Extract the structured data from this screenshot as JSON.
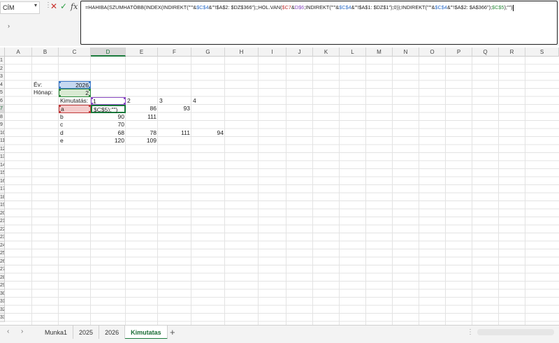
{
  "formula_bar": {
    "name_box": "CÍM",
    "formula_parts": [
      {
        "t": "=HAHIBA(SZUMHATÖBB(INDEX(INDIREKT(\"'\"&",
        "c": ""
      },
      {
        "t": "$C$4",
        "c": "ref-blue"
      },
      {
        "t": "&\"'!$A$2: $DZ$366\");;HOL.VAN(",
        "c": ""
      },
      {
        "t": "$C7",
        "c": "ref-red"
      },
      {
        "t": "&",
        "c": ""
      },
      {
        "t": "D$6",
        "c": "ref-purple"
      },
      {
        "t": ";INDIREKT(\"'\"&",
        "c": ""
      },
      {
        "t": "$C$4",
        "c": "ref-blue"
      },
      {
        "t": "&\"'!$A$1: $DZ$1\");0));INDIREKT(\"'\"&",
        "c": ""
      },
      {
        "t": "$C$4",
        "c": "ref-blue"
      },
      {
        "t": "&\"'!$A$2: $A$366\");",
        "c": ""
      },
      {
        "t": "$C$5",
        "c": "ref-green"
      },
      {
        "t": ");\"\")",
        "c": ""
      }
    ]
  },
  "columns": [
    "A",
    "B",
    "C",
    "D",
    "E",
    "F",
    "G",
    "H",
    "I",
    "J",
    "K",
    "L",
    "M",
    "N",
    "O",
    "P",
    "Q",
    "R",
    "S"
  ],
  "rows": [
    "1",
    "2",
    "3",
    "4",
    "5",
    "6",
    "7",
    "8",
    "9",
    "10",
    "11",
    "12",
    "13",
    "14",
    "15",
    "16",
    "17",
    "18",
    "19",
    "20",
    "21",
    "22",
    "23",
    "24",
    "25",
    "26",
    "27",
    "28",
    "29",
    "30",
    "31",
    "32",
    "33"
  ],
  "cells": {
    "B4": "Év:",
    "C4": "2026",
    "B5": "Hónap:",
    "C5": "2",
    "C6": "Kimutatás:",
    "D6": "1",
    "E6": "2",
    "F6": "3",
    "G6": "4",
    "C7": "a",
    "D7": "$C$5);\"\")",
    "E7": "86",
    "F7": "93",
    "C8": "b",
    "D8": "90",
    "E8": "111",
    "C9": "c",
    "D9": "70",
    "C10": "d",
    "D10": "68",
    "E10": "78",
    "F10": "111",
    "G10": "94",
    "C11": "e",
    "D11": "120",
    "E11": "109"
  },
  "sheets": {
    "tabs": [
      "Munka1",
      "2025",
      "2026",
      "Kimutatas"
    ],
    "active": "Kimutatas"
  }
}
